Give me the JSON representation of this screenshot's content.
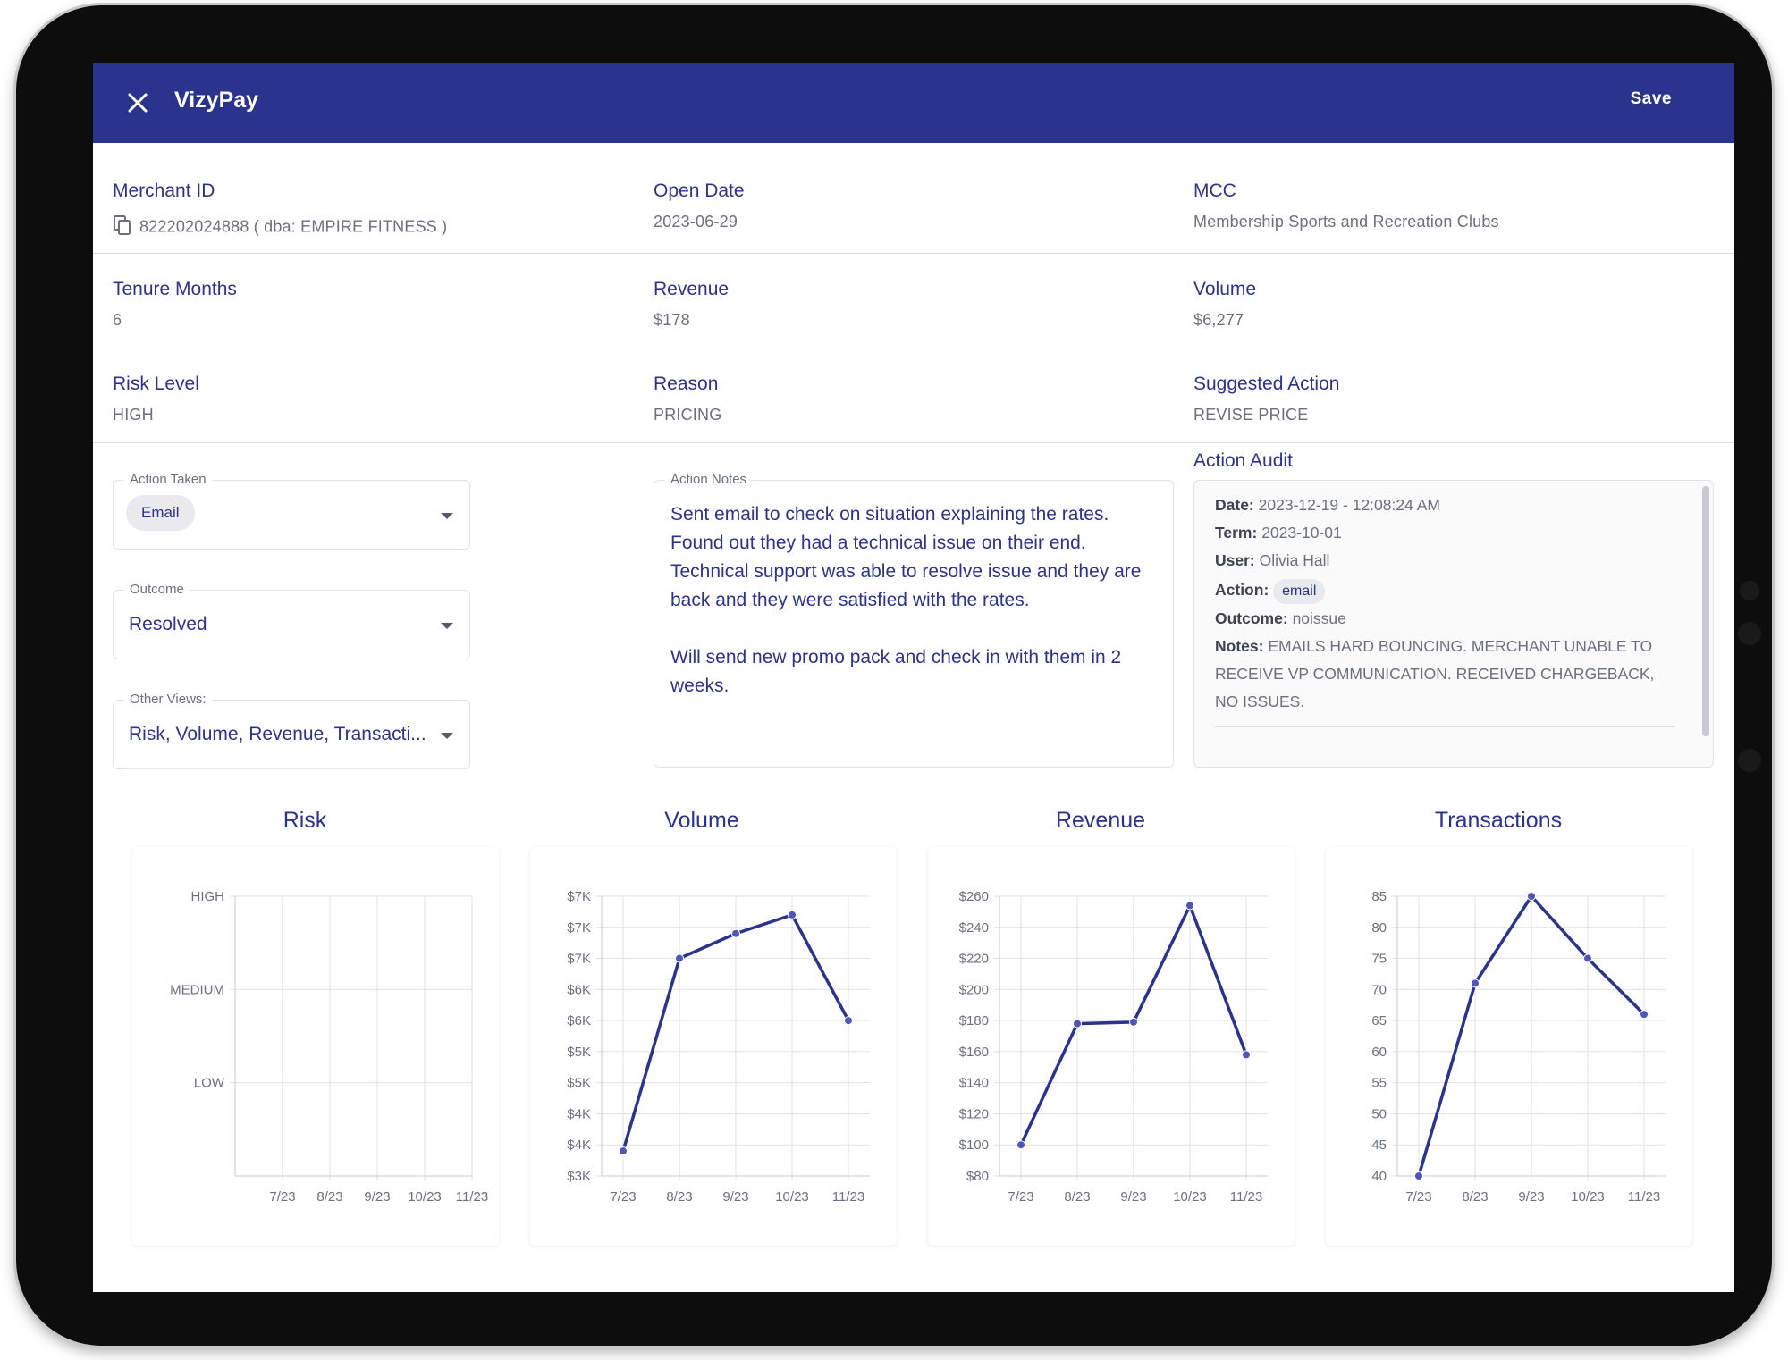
{
  "app": {
    "title": "VizyPay",
    "save_label": "Save"
  },
  "merchant": {
    "merchant_id_label": "Merchant ID",
    "merchant_id_value": "822202024888 ( dba: EMPIRE FITNESS )",
    "open_date_label": "Open Date",
    "open_date_value": "2023-06-29",
    "mcc_label": "MCC",
    "mcc_value": "Membership Sports and Recreation Clubs",
    "tenure_label": "Tenure Months",
    "tenure_value": "6",
    "revenue_label": "Revenue",
    "revenue_value": "$178",
    "volume_label": "Volume",
    "volume_value": "$6,277",
    "risk_label": "Risk Level",
    "risk_value": "HIGH",
    "reason_label": "Reason",
    "reason_value": "PRICING",
    "suggested_label": "Suggested Action",
    "suggested_value": "REVISE PRICE"
  },
  "form": {
    "action_taken_label": "Action Taken",
    "action_taken_value": "Email",
    "outcome_label": "Outcome",
    "outcome_value": "Resolved",
    "other_views_label": "Other Views:",
    "other_views_value": "Risk, Volume, Revenue, Transacti...",
    "action_notes_label": "Action Notes",
    "action_notes_value": "Sent email to check on situation explaining the rates. Found out they had a technical issue on their end. Technical support was able to resolve issue and they are back and they were satisfied with the rates.\n\nWill send new promo pack and check in with them in 2 weeks."
  },
  "audit": {
    "title": "Action Audit",
    "date_label": "Date:",
    "date_value": "2023-12-19 - 12:08:24 AM",
    "term_label": "Term:",
    "term_value": "2023-10-01",
    "user_label": "User:",
    "user_value": "Olivia Hall",
    "action_label": "Action:",
    "action_value": "email",
    "outcome_label": "Outcome:",
    "outcome_value": "noissue",
    "notes_label": "Notes:",
    "notes_value": "EMAILS HARD BOUNCING. MERCHANT UNABLE TO RECEIVE VP COMMUNICATION. RECEIVED CHARGEBACK, NO ISSUES."
  },
  "colors": {
    "primary": "#2b348c",
    "line": "#2b348c",
    "point": "#4f56b8",
    "grid": "#e2e2e6",
    "muted": "#6b6f80"
  },
  "chart_data": [
    {
      "type": "line",
      "title": "Risk",
      "categories": [
        "7/23",
        "8/23",
        "9/23",
        "10/23",
        "11/23"
      ],
      "y_categories": [
        "LOW",
        "MEDIUM",
        "HIGH"
      ],
      "values": [],
      "grid": true
    },
    {
      "type": "line",
      "title": "Volume",
      "categories": [
        "7/23",
        "8/23",
        "9/23",
        "10/23",
        "11/23"
      ],
      "values": [
        3400,
        6500,
        6900,
        7200,
        5500
      ],
      "ylim": [
        3000,
        7500
      ],
      "yticks": [
        3000,
        3500,
        4000,
        4500,
        5000,
        5500,
        6000,
        6500,
        7000,
        7500
      ],
      "ytick_labels": [
        "$3K",
        "$4K",
        "$4K",
        "$5K",
        "$5K",
        "$6K",
        "$6K",
        "$7K",
        "$7K",
        "$7K"
      ],
      "grid": true
    },
    {
      "type": "line",
      "title": "Revenue",
      "categories": [
        "7/23",
        "8/23",
        "9/23",
        "10/23",
        "11/23"
      ],
      "values": [
        100,
        178,
        179,
        254,
        158
      ],
      "ylim": [
        80,
        260
      ],
      "yticks": [
        80,
        100,
        120,
        140,
        160,
        180,
        200,
        220,
        240,
        260
      ],
      "ytick_labels": [
        "$80",
        "$100",
        "$120",
        "$140",
        "$160",
        "$180",
        "$200",
        "$220",
        "$240",
        "$260"
      ],
      "grid": true
    },
    {
      "type": "line",
      "title": "Transactions",
      "categories": [
        "7/23",
        "8/23",
        "9/23",
        "10/23",
        "11/23"
      ],
      "values": [
        40,
        71,
        85,
        75,
        66
      ],
      "ylim": [
        40,
        85
      ],
      "yticks": [
        40,
        45,
        50,
        55,
        60,
        65,
        70,
        75,
        80,
        85
      ],
      "ytick_labels": [
        "40",
        "45",
        "50",
        "55",
        "60",
        "65",
        "70",
        "75",
        "80",
        "85"
      ],
      "grid": true
    }
  ]
}
